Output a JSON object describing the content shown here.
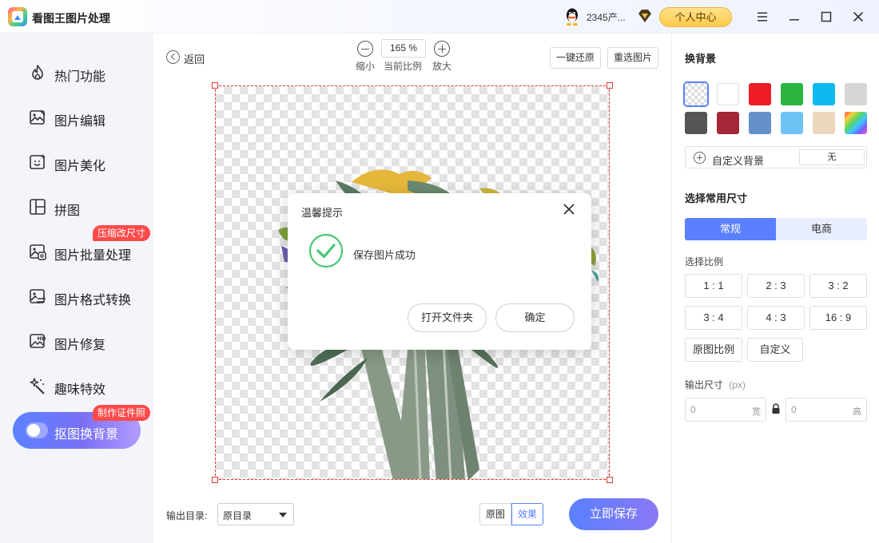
{
  "app": {
    "title": "看图王图片处理"
  },
  "header": {
    "user_name": "2345产...",
    "personal_center": "个人中心"
  },
  "sidebar": {
    "items": [
      {
        "label": "热门功能"
      },
      {
        "label": "图片编辑"
      },
      {
        "label": "图片美化"
      },
      {
        "label": "拼图"
      },
      {
        "label": "图片批量处理",
        "badge": "压缩改尺寸"
      },
      {
        "label": "图片格式转换"
      },
      {
        "label": "图片修复"
      },
      {
        "label": "趣味特效"
      },
      {
        "label": "抠图换背景",
        "badge": "制作证件照",
        "active": true
      }
    ]
  },
  "toolbar": {
    "back": "返回",
    "zoom_value": "165 %",
    "zoom_out": "缩小",
    "current_ratio": "当前比例",
    "zoom_in": "放大",
    "reset": "一键还原",
    "reselect": "重选图片"
  },
  "footer": {
    "output_dir_label": "输出目录:",
    "output_dir_value": "原目录",
    "view_original": "原图",
    "view_effect": "效果",
    "save_now": "立即保存"
  },
  "right_panel": {
    "bg_title": "换背景",
    "colors": [
      "transparent",
      "#ffffff",
      "#ee1c25",
      "#2ab541",
      "#0dbaf0",
      "#d6d6d6",
      "#555555",
      "#a52636",
      "#6390c8",
      "#6ec3f5",
      "#edd6be",
      "rainbow"
    ],
    "custom_bg_label": "自定义背景",
    "custom_bg_value": "无",
    "size_title": "选择常用尺寸",
    "size_tabs": [
      "常规",
      "电商"
    ],
    "ratio_label": "选择比例",
    "ratios": [
      "1 : 1",
      "2 : 3",
      "3 : 2",
      "3 : 4",
      "4 : 3",
      "16 : 9",
      "原图比例",
      "自定义"
    ],
    "output_size_label": "输出尺寸",
    "output_size_unit": "(px)",
    "width_value": "0",
    "width_unit": "宽",
    "height_value": "0",
    "height_unit": "高"
  },
  "modal": {
    "title": "温馨提示",
    "message": "保存图片成功",
    "open_folder": "打开文件夹",
    "confirm": "确定"
  }
}
